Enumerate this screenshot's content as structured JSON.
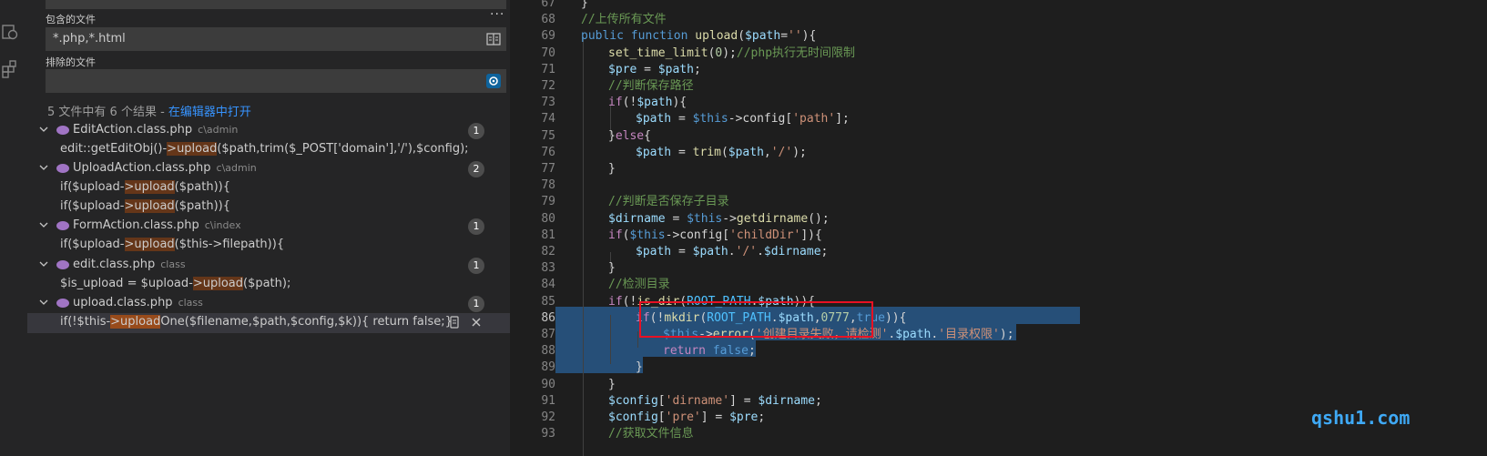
{
  "search": {
    "include_label": "包含的文件",
    "include_value": "*.php,*.html",
    "exclude_label": "排除的文件",
    "exclude_value": "",
    "summary_text": "5 文件中有 6 个结果 - ",
    "summary_link": "在编辑器中打开",
    "results": [
      {
        "file": "EditAction.class.php",
        "path": "c\\admin",
        "count": "1",
        "matches": [
          {
            "pre": "edit::getEditObj()-",
            "hl": ">upload",
            "post": "($path,trim($_POST['domain'],'/'),$config);"
          }
        ]
      },
      {
        "file": "UploadAction.class.php",
        "path": "c\\admin",
        "count": "2",
        "matches": [
          {
            "pre": "if($upload-",
            "hl": ">upload",
            "post": "($path)){"
          },
          {
            "pre": "if($upload-",
            "hl": ">upload",
            "post": "($path)){"
          }
        ]
      },
      {
        "file": "FormAction.class.php",
        "path": "c\\index",
        "count": "1",
        "matches": [
          {
            "pre": "if($upload-",
            "hl": ">upload",
            "post": "($this->filepath)){"
          }
        ]
      },
      {
        "file": "edit.class.php",
        "path": "class",
        "count": "1",
        "matches": [
          {
            "pre": "$is_upload = $upload-",
            "hl": ">upload",
            "post": "($path);"
          }
        ]
      },
      {
        "file": "upload.class.php",
        "path": "class",
        "count": "1",
        "matches": [
          {
            "pre": "if(!$this-",
            "hl": ">upload",
            "post": "One($filename,$path,$config,$k)){ return false;}"
          }
        ]
      }
    ]
  },
  "editor": {
    "lines": [
      {
        "n": "67",
        "code": "}"
      },
      {
        "n": "68",
        "code": "//上传所有文件"
      },
      {
        "n": "69",
        "code": "public function upload($path=''){"
      },
      {
        "n": "70",
        "code": "set_time_limit(0);//php执行无时间限制"
      },
      {
        "n": "71",
        "code": "$pre = $path;"
      },
      {
        "n": "72",
        "code": "//判断保存路径"
      },
      {
        "n": "73",
        "code": "if(!$path){"
      },
      {
        "n": "74",
        "code": "$path = $this->config['path'];"
      },
      {
        "n": "75",
        "code": "}else{"
      },
      {
        "n": "76",
        "code": "$path = trim($path,'/');"
      },
      {
        "n": "77",
        "code": "}"
      },
      {
        "n": "78",
        "code": ""
      },
      {
        "n": "79",
        "code": "//判断是否保存子目录"
      },
      {
        "n": "80",
        "code": "$dirname = $this->getdirname();"
      },
      {
        "n": "81",
        "code": "if($this->config['childDir']){"
      },
      {
        "n": "82",
        "code": "$path = $path.'/'.$dirname;"
      },
      {
        "n": "83",
        "code": "}"
      },
      {
        "n": "84",
        "code": "//检测目录"
      },
      {
        "n": "85",
        "code": "if(!is_dir(ROOT_PATH.$path)){"
      },
      {
        "n": "86",
        "code": "if(!mkdir(ROOT_PATH.$path,0777,true)){"
      },
      {
        "n": "87",
        "code": "$this->error('创建目录失败，请检测'.$path.'目录权限');"
      },
      {
        "n": "88",
        "code": "return false;"
      },
      {
        "n": "89",
        "code": "}"
      },
      {
        "n": "90",
        "code": "}"
      },
      {
        "n": "91",
        "code": "$config['dirname'] = $dirname;"
      },
      {
        "n": "92",
        "code": "$config['pre'] = $pre;"
      },
      {
        "n": "93",
        "code": "//获取文件信息"
      }
    ]
  },
  "watermark": "qshu1.com",
  "colors": {
    "selection": "#264f78",
    "highlight": "#ea5c00",
    "annotation": "#e81123",
    "link": "#3794ff"
  }
}
